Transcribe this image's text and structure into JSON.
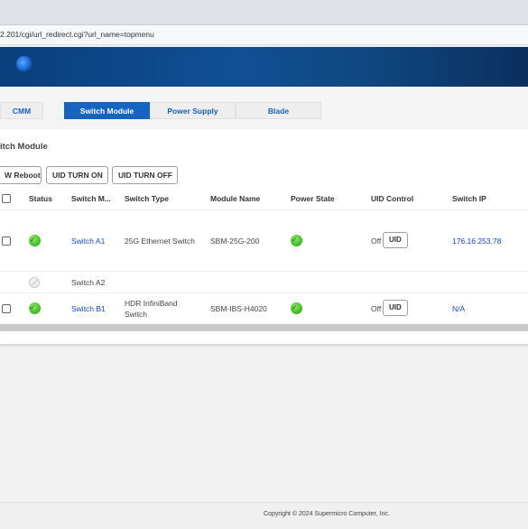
{
  "browser": {
    "url": "2.201/cgi/url_redirect.cgi?url_name=topmenu"
  },
  "tabs": [
    {
      "label": "CMM",
      "active": false
    },
    {
      "label": "Switch Module",
      "active": true
    },
    {
      "label": "Power Supply",
      "active": false
    },
    {
      "label": "Blade",
      "active": false
    }
  ],
  "section": {
    "title": "itch Module"
  },
  "toolbar": {
    "sw_reboot": "W Reboot",
    "uid_on": "UID TURN ON",
    "uid_off": "UID TURN OFF"
  },
  "table": {
    "headers": [
      "Status",
      "Switch M...",
      "Switch Type",
      "Module Name",
      "Power State",
      "UID Control",
      "Switch IP"
    ],
    "rows": [
      {
        "status": "ok",
        "switch": "Switch A1",
        "type": "25G Ethernet Switch",
        "module": "SBM-25G-200",
        "power": "ok",
        "uid_state": "Off",
        "uid_label": "UID",
        "ip": "176.16.253.78"
      },
      {
        "status": "absent",
        "switch": "Switch A2",
        "type": "",
        "module": "",
        "power": "",
        "uid_state": "",
        "uid_label": "",
        "ip": ""
      },
      {
        "status": "ok",
        "switch": "Switch B1",
        "type": "HDR InfiniBand Switch",
        "type_line1": "HDR InfiniBand",
        "type_line2": "Switch",
        "module": "SBM-IBS-H4020",
        "power": "ok",
        "uid_state": "Off",
        "uid_label": "UID",
        "ip": "N/A"
      }
    ]
  },
  "footer": {
    "copyright": "Copyright © 2024 Supermicro Computer, Inc."
  },
  "colors": {
    "brand_blue": "#1565c0",
    "link_blue": "#1a44c8",
    "status_ok": "#43c42b"
  },
  "icons": {
    "status_ok": "green-check-circle-icon",
    "status_absent": "gray-disabled-circle-icon"
  }
}
